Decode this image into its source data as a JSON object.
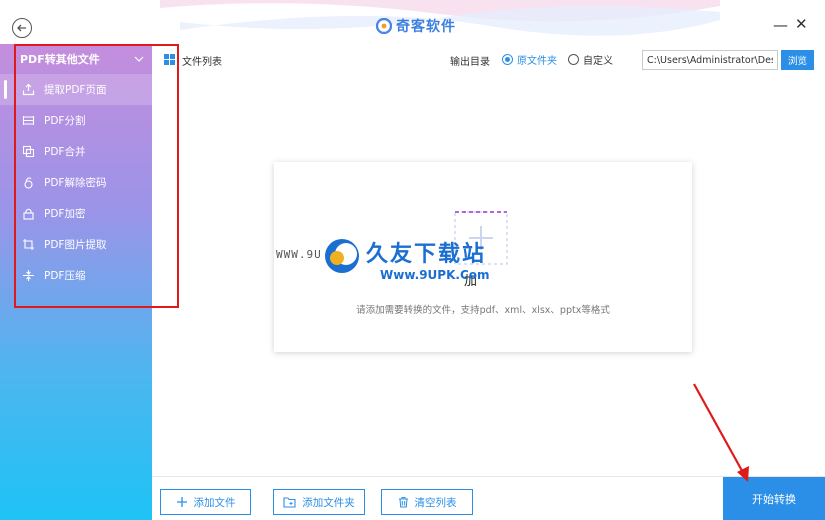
{
  "app": {
    "brand_name": "奇客软件"
  },
  "window": {
    "minimize_glyph": "—",
    "close_glyph": "✕"
  },
  "sidebar": {
    "header_label": "PDF转其他文件",
    "items": [
      {
        "label": "提取PDF页面",
        "icon": "export-icon",
        "active": true
      },
      {
        "label": "PDF分割",
        "icon": "split-icon"
      },
      {
        "label": "PDF合并",
        "icon": "merge-icon"
      },
      {
        "label": "PDF解除密码",
        "icon": "unlock-icon"
      },
      {
        "label": "PDF加密",
        "icon": "lock-icon"
      },
      {
        "label": "PDF图片提取",
        "icon": "crop-icon"
      },
      {
        "label": "PDF压缩",
        "icon": "compress-icon"
      }
    ]
  },
  "toolbar": {
    "file_list_label": "文件列表",
    "output_dir_label": "输出目录",
    "radio_original": "原文件夹",
    "radio_custom": "自定义",
    "path_value": "C:\\Users\\Administrator\\Desk",
    "browse_label": "浏览"
  },
  "drop_zone": {
    "title": "加",
    "hint": "请添加需要转换的文件，支持pdf、xml、xlsx、pptx等格式"
  },
  "watermark": {
    "www": "WWW.9U",
    "cn_text": "久友下载站",
    "url": "Www.9UPK.Com"
  },
  "bottom": {
    "add_file_label": "添加文件",
    "add_folder_label": "添加文件夹",
    "clear_list_label": "清空列表",
    "start_label": "开始转换"
  },
  "colors": {
    "accent": "#2b8fe8",
    "highlight_box": "#e01a1a"
  }
}
